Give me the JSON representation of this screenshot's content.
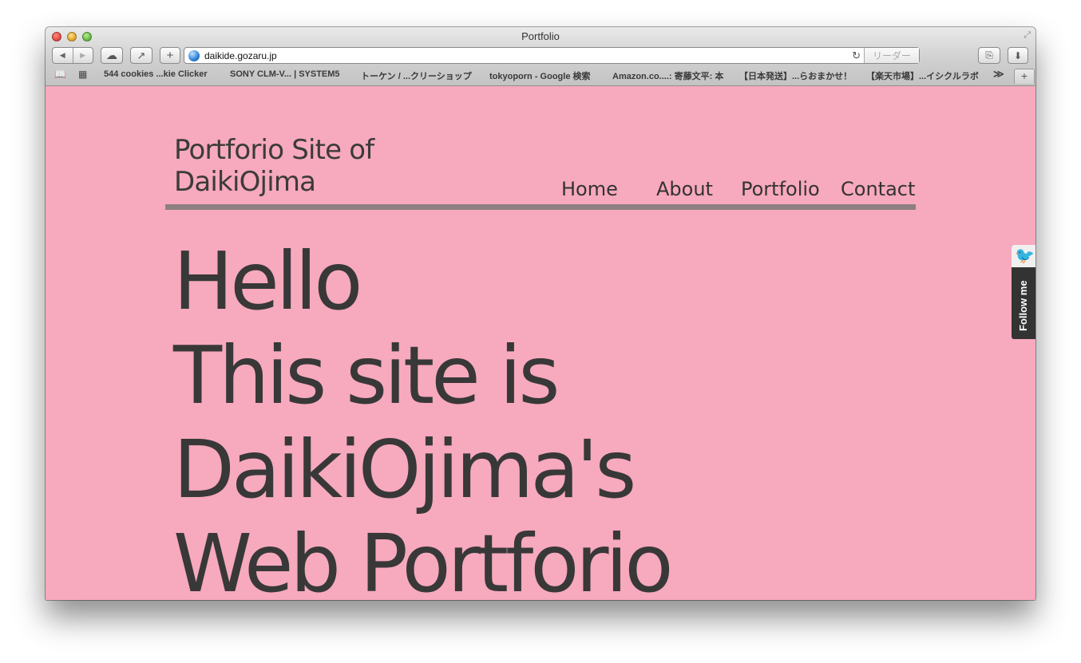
{
  "window": {
    "title": "Portfolio"
  },
  "toolbar": {
    "back_icon": "◀",
    "forward_icon": "▶",
    "cloud_icon": "☁",
    "share_icon": "↗",
    "add_icon": "+",
    "url": "daikide.gozaru.jp",
    "reload_icon": "↻",
    "reader_label": "リーダー",
    "reading_list_icon": "⎘",
    "downloads_icon": "⬇"
  },
  "bookmarks": {
    "book_icon": "📖",
    "grid_icon": "▦",
    "items": [
      "544 cookies ...kie Clicker",
      "SONY CLM-V... | SYSTEM5",
      "トーケン / ...クリーショップ",
      "tokyoporn - Google 検索",
      "Amazon.co....: 寄藤文平: 本",
      "【日本発送】...らおまかせ！",
      "【楽天市場】...イシクルラボ"
    ],
    "more_label": "≫",
    "new_tab_label": "+"
  },
  "site": {
    "title": "Portforio Site of DaikiOjima",
    "nav": [
      "Home",
      "About",
      "Portfolio",
      "Contact"
    ],
    "hero": [
      "Hello",
      "This site is",
      "DaikiOjima's",
      "Web Portforio"
    ],
    "follow_label": "Follow me"
  },
  "colors": {
    "page_background": "#f7a9bd",
    "text": "#383838",
    "rule": "#8b7f81",
    "follow_tab": "#333333"
  }
}
